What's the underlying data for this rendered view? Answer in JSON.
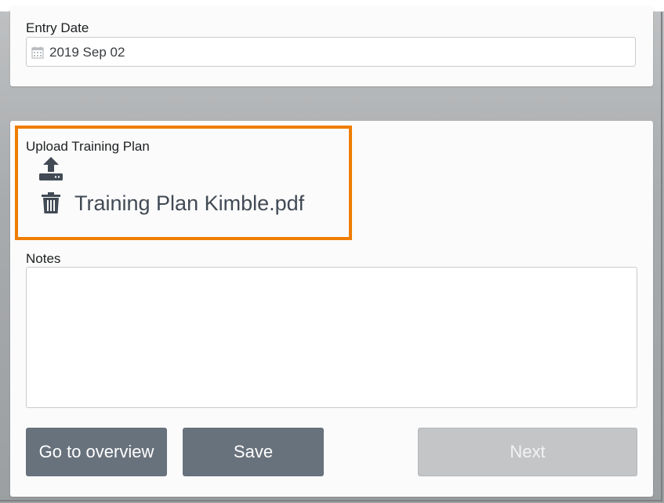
{
  "entry_date": {
    "label": "Entry Date",
    "value": "2019 Sep 02"
  },
  "upload": {
    "label": "Upload Training Plan",
    "file_name": "Training Plan Kimble.pdf",
    "highlight_color": "#ef7d00"
  },
  "notes": {
    "label": "Notes",
    "value": ""
  },
  "buttons": {
    "overview_label": "Go to overview",
    "save_label": "Save",
    "next_label": "Next"
  },
  "colors": {
    "primary_button": "#68727d",
    "disabled_button": "#c3c5c7",
    "icon": "#414a55"
  }
}
